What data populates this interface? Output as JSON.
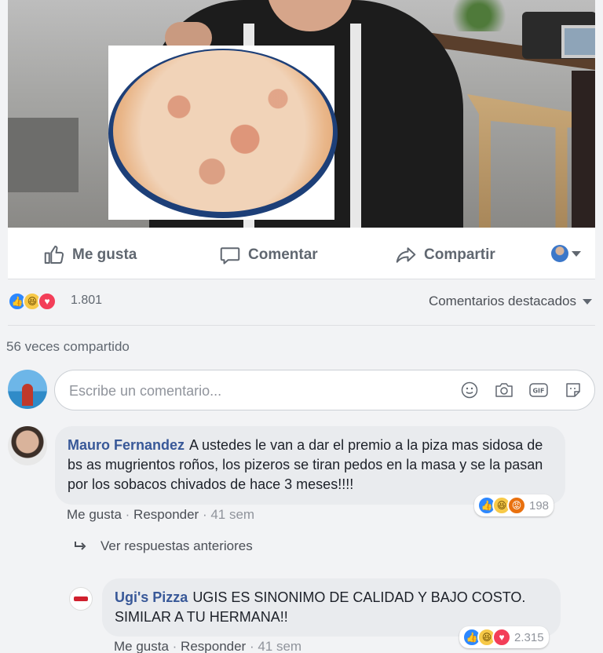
{
  "post": {
    "actions": {
      "like_label": "Me gusta",
      "comment_label": "Comentar",
      "share_label": "Compartir"
    },
    "reactions": {
      "icons": [
        "like-reaction",
        "haha-reaction",
        "love-reaction"
      ],
      "count": "1.801"
    },
    "top_comments_label": "Comentarios destacados",
    "shares_text": "56 veces compartido"
  },
  "composer": {
    "placeholder": "Escribe un comentario...",
    "icons": [
      "emoji-icon",
      "camera-icon",
      "gif-icon",
      "sticker-icon"
    ]
  },
  "comments": [
    {
      "author": "Mauro Fernandez",
      "text": "A ustedes le van a dar el premio a la piza mas sidosa de bs as mugrientos roños, los pizeros se tiran pedos en la masa y se la pasan por los sobacos chivados de hace 3 meses!!!!",
      "reactions": [
        "like-reaction",
        "haha-reaction",
        "angry-reaction"
      ],
      "reaction_count": "198",
      "like_label": "Me gusta",
      "reply_label": "Responder",
      "time": "41 sem"
    }
  ],
  "replies": {
    "view_previous_label": "Ver respuestas anteriores",
    "items": [
      {
        "author": "Ugi's Pizza",
        "text": "UGIS ES SINONIMO DE CALIDAD Y BAJO COSTO. SIMILAR A TU HERMANA!!",
        "reactions": [
          "like-reaction",
          "haha-reaction",
          "love-reaction"
        ],
        "reaction_count": "2.315",
        "like_label": "Me gusta",
        "reply_label": "Responder",
        "time": "41 sem"
      }
    ]
  },
  "colors": {
    "link_blue": "#385898",
    "like_blue": "#2d88ff",
    "love_red": "#f33e58",
    "haha_yellow": "#f7c948",
    "angry_orange": "#e9710f"
  }
}
